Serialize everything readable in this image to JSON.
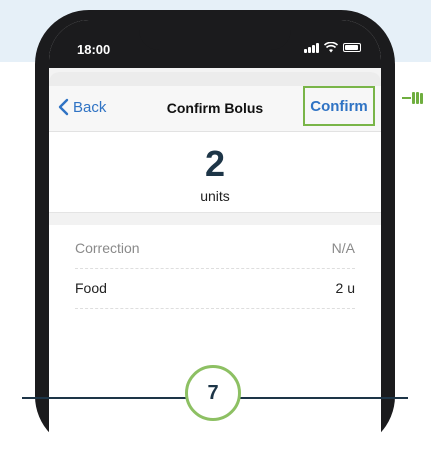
{
  "status_bar": {
    "time": "18:00"
  },
  "nav": {
    "back_label": "Back",
    "title": "Confirm Bolus",
    "confirm_label": "Confirm"
  },
  "bolus": {
    "amount": "2",
    "units_label": "units"
  },
  "rows": [
    {
      "label": "Correction",
      "value": "N/A"
    },
    {
      "label": "Food",
      "value": "2 u"
    }
  ],
  "step": {
    "number": "7"
  },
  "colors": {
    "accent_blue": "#2f73c4",
    "highlight_green": "#79b548",
    "dark_navy": "#1d3547",
    "hint_green": "#6fae3f"
  },
  "icons": [
    "chevron-left-icon",
    "signal-icon",
    "wifi-icon",
    "battery-icon",
    "hand-pointer-icon"
  ]
}
